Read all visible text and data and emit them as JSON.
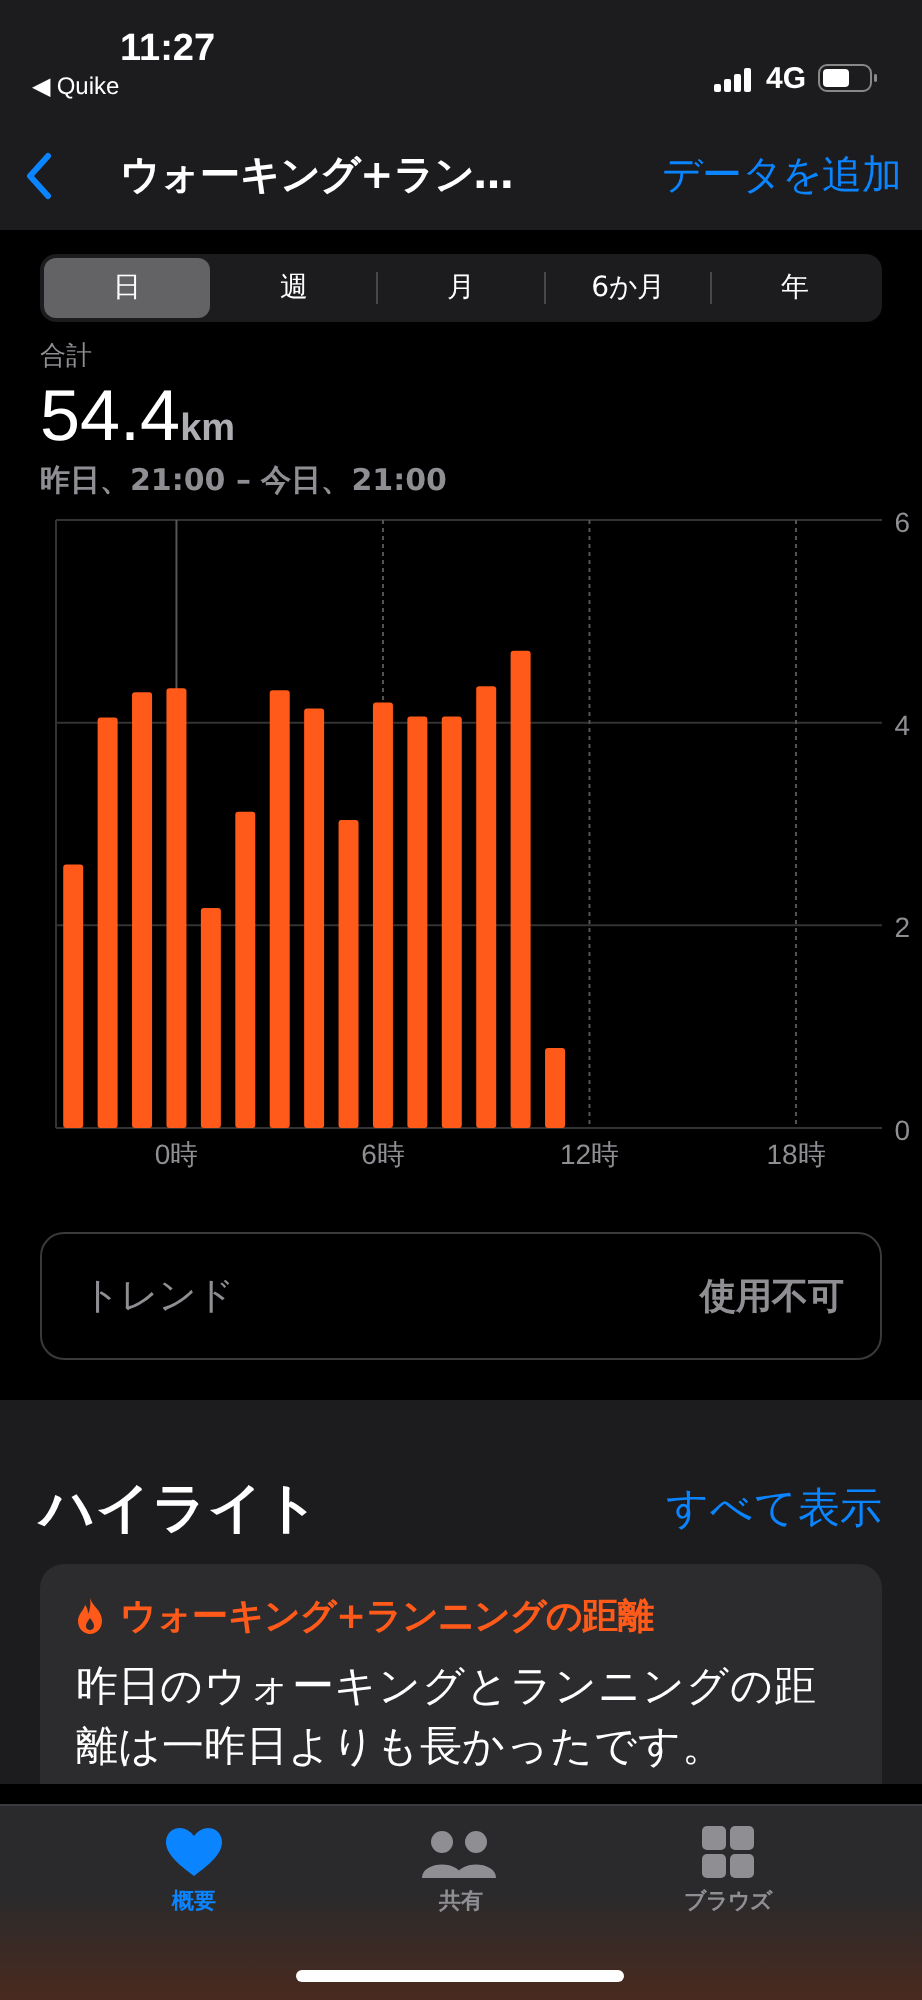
{
  "status_bar": {
    "time": "11:27",
    "back_app": "◀ Quike",
    "network": "4G"
  },
  "nav": {
    "title": "ウォーキング+ラン…",
    "action": "データを追加"
  },
  "segments": [
    {
      "label": "日",
      "selected": true
    },
    {
      "label": "週",
      "selected": false
    },
    {
      "label": "月",
      "selected": false
    },
    {
      "label": "6か月",
      "selected": false
    },
    {
      "label": "年",
      "selected": false
    }
  ],
  "summary": {
    "label": "合計",
    "value": "54.4",
    "unit": "km",
    "range": "昨日、21:00 – 今日、21:00"
  },
  "chart_data": {
    "type": "bar",
    "x": [
      -3,
      -2,
      -1,
      0,
      1,
      2,
      3,
      4,
      5,
      6,
      7,
      8,
      9,
      10,
      11
    ],
    "series": [
      {
        "color": "#ff5a1a",
        "values": [
          2.6,
          4.05,
          4.3,
          4.34,
          2.17,
          3.12,
          4.32,
          4.14,
          3.04,
          4.2,
          4.06,
          4.06,
          4.36,
          4.71,
          0.79
        ]
      }
    ],
    "grid": true,
    "ylim": [
      0,
      6
    ],
    "yticks": [
      0,
      2,
      4,
      6
    ],
    "xlim": [
      -3.5,
      20.5
    ],
    "xticks": [
      {
        "value": 0,
        "label": "0時"
      },
      {
        "value": 6,
        "label": "6時"
      },
      {
        "value": 12,
        "label": "12時"
      },
      {
        "value": 18,
        "label": "18時"
      }
    ]
  },
  "trend": {
    "label": "トレンド",
    "value": "使用不可"
  },
  "highlights": {
    "title": "ハイライト",
    "action": "すべて表示",
    "card": {
      "title": "ウォーキング+ランニングの距離",
      "text": "昨日のウォーキングとランニングの距離は一昨日よりも長かったです。"
    }
  },
  "tab_bar": [
    {
      "label": "概要",
      "kind": "heart",
      "selected": true
    },
    {
      "label": "共有",
      "kind": "people",
      "selected": false
    },
    {
      "label": "ブラウズ",
      "kind": "grid",
      "selected": false
    }
  ]
}
